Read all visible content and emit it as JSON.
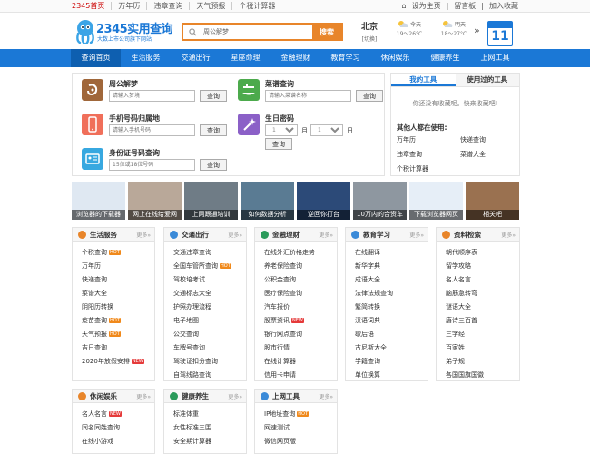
{
  "topbar": {
    "links": [
      "2345首页",
      "万年历",
      "违章查询",
      "天气预报",
      "个税计算器"
    ],
    "right": [
      "设为主页",
      "留言板",
      "加入收藏"
    ]
  },
  "logo": {
    "title": "2345实用查询",
    "subtitle": "大数上市公司旗下网站"
  },
  "search": {
    "value": "周公解梦",
    "button": "搜索"
  },
  "weather": {
    "city": "北京",
    "switch": "[切换]",
    "today": {
      "label": "今天",
      "temp": "19～26°C"
    },
    "tomorrow": {
      "label": "明天",
      "temp": "18～27°C"
    },
    "arrow": "»"
  },
  "calendar": {
    "day": "11"
  },
  "nav": [
    "查询首页",
    "生活服务",
    "交通出行",
    "星座命理",
    "金融理财",
    "教育学习",
    "休闲娱乐",
    "健康养生",
    "上网工具"
  ],
  "tools": {
    "dream": {
      "name": "周公解梦",
      "placeholder": "请输入梦境",
      "button": "查询"
    },
    "trash": {
      "name": "菜谱查询",
      "placeholder": "请输入菜谱名称",
      "button": "查询"
    },
    "phone": {
      "name": "手机号码归属地",
      "placeholder": "请输入手机号码",
      "button": "查询"
    },
    "birthday": {
      "name": "生日密码",
      "month_label": "月",
      "day_label": "日",
      "month_sel": "1",
      "day_sel": "1",
      "button": "查询"
    },
    "idcard": {
      "name": "身份证号码查询",
      "placeholder": "15位或18位号码",
      "button": "查询"
    }
  },
  "mytools": {
    "tabs": [
      "我的工具",
      "使用过的工具"
    ],
    "empty": "你还没有收藏呢。快来收藏吧!",
    "others_title": "其他人都在使用:",
    "others": [
      "万年历",
      "快递查询",
      "违章查询",
      "菜谱大全",
      "个税计算器"
    ]
  },
  "pics": [
    {
      "caption": "浏览器的下载器",
      "bg": "#dfe8f2"
    },
    {
      "caption": "网上在线给爱网",
      "bg": "#b9a899"
    },
    {
      "caption": "上网跟通培训",
      "bg": "#6f7c86"
    },
    {
      "caption": "如何数据分析",
      "bg": "#5a7b93"
    },
    {
      "caption": "逆回你打台",
      "bg": "#2c4a78"
    },
    {
      "caption": "10万内的合资车",
      "bg": "#8e97a0"
    },
    {
      "caption": "下载浏览器网页",
      "bg": "#e6eef7"
    },
    {
      "caption": "相关吧",
      "bg": "#9a7150"
    }
  ],
  "categories": [
    {
      "id": "life",
      "title": "生活服务",
      "more": "更多»",
      "color": "#e8852a",
      "items": [
        {
          "t": "个税查询",
          "b": "HOT"
        },
        {
          "t": "万年历",
          "b": ""
        },
        {
          "t": "快递查询",
          "b": ""
        },
        {
          "t": "菜谱大全",
          "b": ""
        },
        {
          "t": "阴阳历转换",
          "b": ""
        },
        {
          "t": "疫苗查询",
          "b": "HOT"
        },
        {
          "t": "天气预报",
          "b": "HOT"
        },
        {
          "t": "吉日查询",
          "b": ""
        },
        {
          "t": "2020年放假安排",
          "b": "NEW"
        }
      ]
    },
    {
      "id": "traffic",
      "title": "交通出行",
      "more": "更多»",
      "color": "#3a8ad8",
      "items": [
        {
          "t": "交通违章查询",
          "b": ""
        },
        {
          "t": "全国车管所查询",
          "b": "HOT"
        },
        {
          "t": "驾校培考试",
          "b": ""
        },
        {
          "t": "交通标志大全",
          "b": ""
        },
        {
          "t": "护照办理流程",
          "b": ""
        },
        {
          "t": "电子地图",
          "b": ""
        },
        {
          "t": "公交查询",
          "b": ""
        },
        {
          "t": "车牌号查询",
          "b": ""
        },
        {
          "t": "驾驶证扣分查询",
          "b": ""
        },
        {
          "t": "自驾线路查询",
          "b": ""
        }
      ]
    },
    {
      "id": "finance",
      "title": "金融理财",
      "more": "更多»",
      "color": "#2a9a5a",
      "items": [
        {
          "t": "在线外汇价格走势",
          "b": ""
        },
        {
          "t": "养老保险查询",
          "b": ""
        },
        {
          "t": "公积金查询",
          "b": ""
        },
        {
          "t": "医疗保险查询",
          "b": ""
        },
        {
          "t": "汽车报价",
          "b": ""
        },
        {
          "t": "股票资讯",
          "b": "NEW"
        },
        {
          "t": "银行网点查询",
          "b": ""
        },
        {
          "t": "股市行情",
          "b": ""
        },
        {
          "t": "在线计算器",
          "b": ""
        },
        {
          "t": "信用卡申请",
          "b": ""
        }
      ]
    },
    {
      "id": "edu",
      "title": "教育学习",
      "more": "更多»",
      "color": "#3a8ad8",
      "items": [
        {
          "t": "在线翻译",
          "b": ""
        },
        {
          "t": "新华字典",
          "b": ""
        },
        {
          "t": "成语大全",
          "b": ""
        },
        {
          "t": "法律法规查询",
          "b": ""
        },
        {
          "t": "繁简转换",
          "b": ""
        },
        {
          "t": "汉语词典",
          "b": ""
        },
        {
          "t": "歇后语",
          "b": ""
        },
        {
          "t": "古尼斯大全",
          "b": ""
        },
        {
          "t": "学籍查询",
          "b": ""
        },
        {
          "t": "单位换算",
          "b": ""
        }
      ]
    },
    {
      "id": "data",
      "title": "资料检索",
      "more": "更多»",
      "color": "#e8852a",
      "items": [
        {
          "t": "朝代顺序表",
          "b": ""
        },
        {
          "t": "留学攻略",
          "b": ""
        },
        {
          "t": "名人名言",
          "b": ""
        },
        {
          "t": "脑筋急转弯",
          "b": ""
        },
        {
          "t": "谜语大全",
          "b": ""
        },
        {
          "t": "唐诗三百首",
          "b": ""
        },
        {
          "t": "三字经",
          "b": ""
        },
        {
          "t": "百家姓",
          "b": ""
        },
        {
          "t": "弟子规",
          "b": ""
        },
        {
          "t": "各国国旗国徽",
          "b": ""
        }
      ]
    },
    {
      "id": "fun",
      "title": "休闲娱乐",
      "more": "更多»",
      "color": "#e8852a",
      "items": [
        {
          "t": "名人名言",
          "b": "NEW"
        },
        {
          "t": "同名同姓查询",
          "b": ""
        },
        {
          "t": "在线小游戏",
          "b": ""
        }
      ]
    },
    {
      "id": "health",
      "title": "健康养生",
      "more": "更多»",
      "color": "#2a9a5a",
      "items": [
        {
          "t": "标准体重",
          "b": ""
        },
        {
          "t": "女性标准三围",
          "b": ""
        },
        {
          "t": "安全期计算器",
          "b": ""
        }
      ]
    },
    {
      "id": "web",
      "title": "上网工具",
      "more": "更多»",
      "color": "#3a8ad8",
      "items": [
        {
          "t": "IP地址查询",
          "b": "HOT"
        },
        {
          "t": "网速测试",
          "b": ""
        },
        {
          "t": "微信网页版",
          "b": ""
        }
      ]
    }
  ]
}
